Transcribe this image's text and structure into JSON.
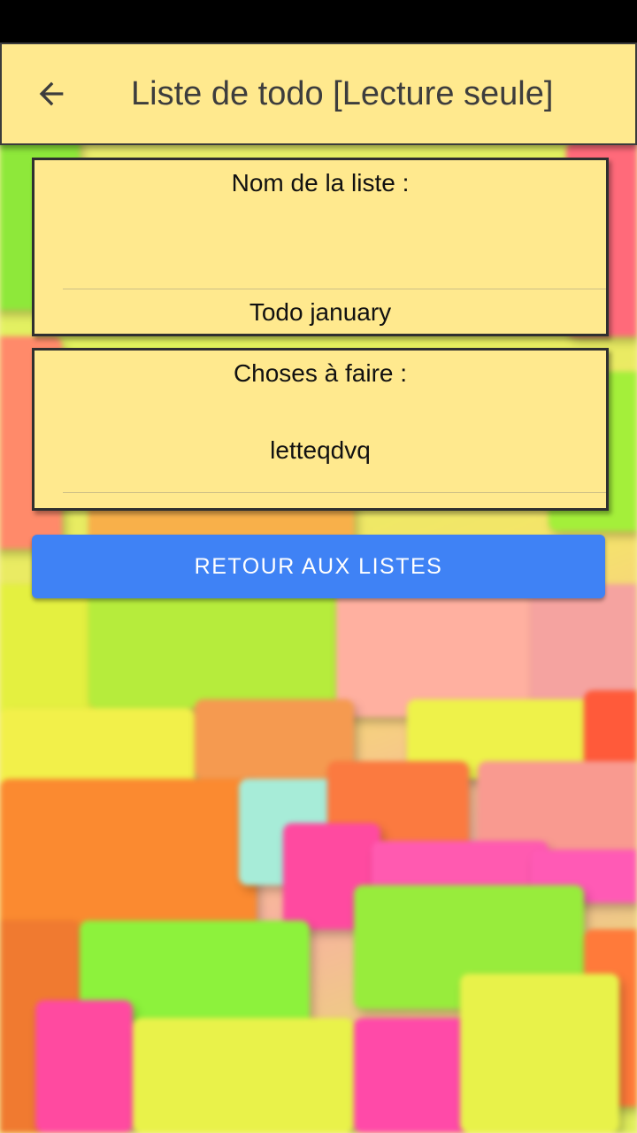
{
  "appbar": {
    "title": "Liste de todo [Lecture seule]",
    "back_icon": "arrow-left-icon"
  },
  "name_card": {
    "label": "Nom de la liste :",
    "value": "Todo january"
  },
  "todo_card": {
    "label": "Choses à faire :",
    "value": "letteqdvq"
  },
  "actions": {
    "back_to_lists_label": "RETOUR AUX LISTES"
  },
  "colors": {
    "appbar_bg": "#ffe98e",
    "card_bg": "#ffe98e",
    "button_bg": "#3f82f5",
    "status_bar": "#000000"
  }
}
